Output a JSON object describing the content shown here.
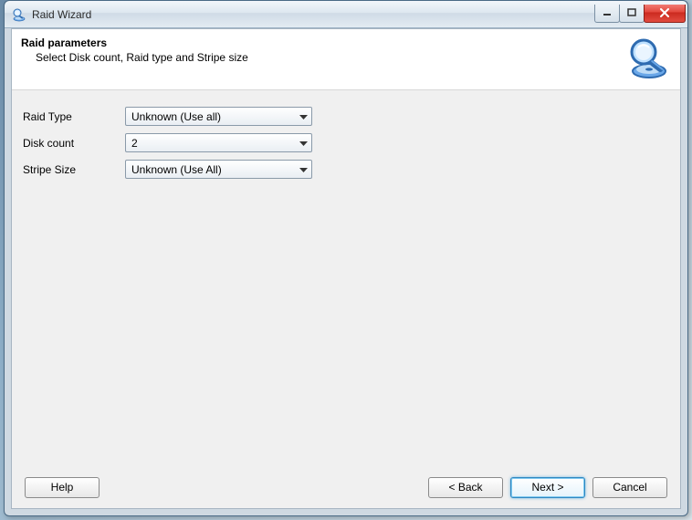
{
  "window": {
    "title": "Raid Wizard"
  },
  "header": {
    "title": "Raid parameters",
    "subtitle": "Select Disk count, Raid type and Stripe size"
  },
  "form": {
    "raid_type": {
      "label": "Raid Type",
      "value": "Unknown (Use all)"
    },
    "disk_count": {
      "label": "Disk count",
      "value": "2"
    },
    "stripe_size": {
      "label": "Stripe Size",
      "value": "Unknown (Use All)"
    }
  },
  "buttons": {
    "help": "Help",
    "back": "< Back",
    "next": "Next >",
    "cancel": "Cancel"
  },
  "icons": {
    "app": "magnifier-disc",
    "header": "magnifier-disc"
  }
}
